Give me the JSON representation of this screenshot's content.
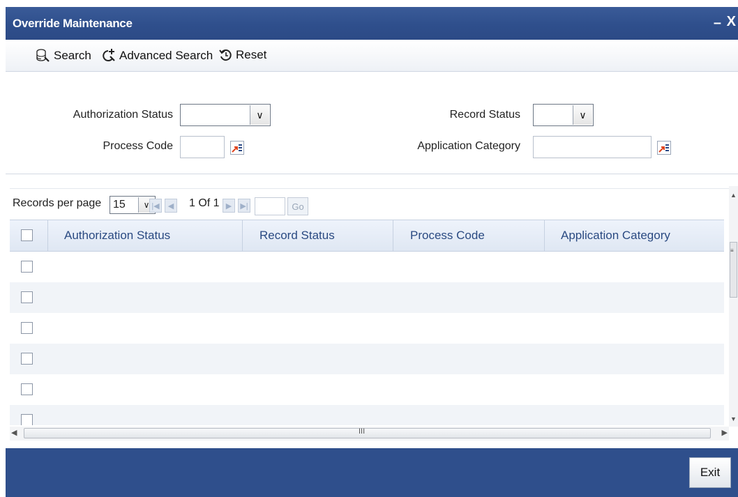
{
  "window": {
    "title": "Override Maintenance",
    "minimize_label": "–",
    "close_label": "X"
  },
  "toolbar": {
    "search_label": "Search",
    "advanced_search_label": "Advanced Search",
    "reset_label": "Reset",
    "search_icon": "search-db-icon",
    "advanced_search_icon": "advanced-search-icon",
    "reset_icon": "reset-icon"
  },
  "criteria": {
    "authorization_status_label": "Authorization Status",
    "authorization_status_value": "",
    "record_status_label": "Record Status",
    "record_status_value": "",
    "process_code_label": "Process Code",
    "process_code_value": "",
    "application_category_label": "Application Category",
    "application_category_value": ""
  },
  "pager": {
    "records_per_page_label": "Records per page",
    "records_per_page_value": "15",
    "page_info": "1 Of 1",
    "go_label": "Go"
  },
  "grid": {
    "columns": [
      "Authorization Status",
      "Record Status",
      "Process Code",
      "Application Category"
    ],
    "rows": [
      [
        "",
        "",
        "",
        ""
      ],
      [
        "",
        "",
        "",
        ""
      ],
      [
        "",
        "",
        "",
        ""
      ],
      [
        "",
        "",
        "",
        ""
      ],
      [
        "",
        "",
        "",
        ""
      ],
      [
        "",
        "",
        "",
        ""
      ]
    ]
  },
  "hscroll": {
    "grip": "III"
  },
  "vscroll": {
    "grip": "≡"
  },
  "footer": {
    "exit_label": "Exit"
  },
  "colors": {
    "titlebar": "#2f4f8c",
    "footer": "#2f4f8c",
    "header_text": "#2a4a82",
    "lov_icon_accent": "#e0431c"
  }
}
